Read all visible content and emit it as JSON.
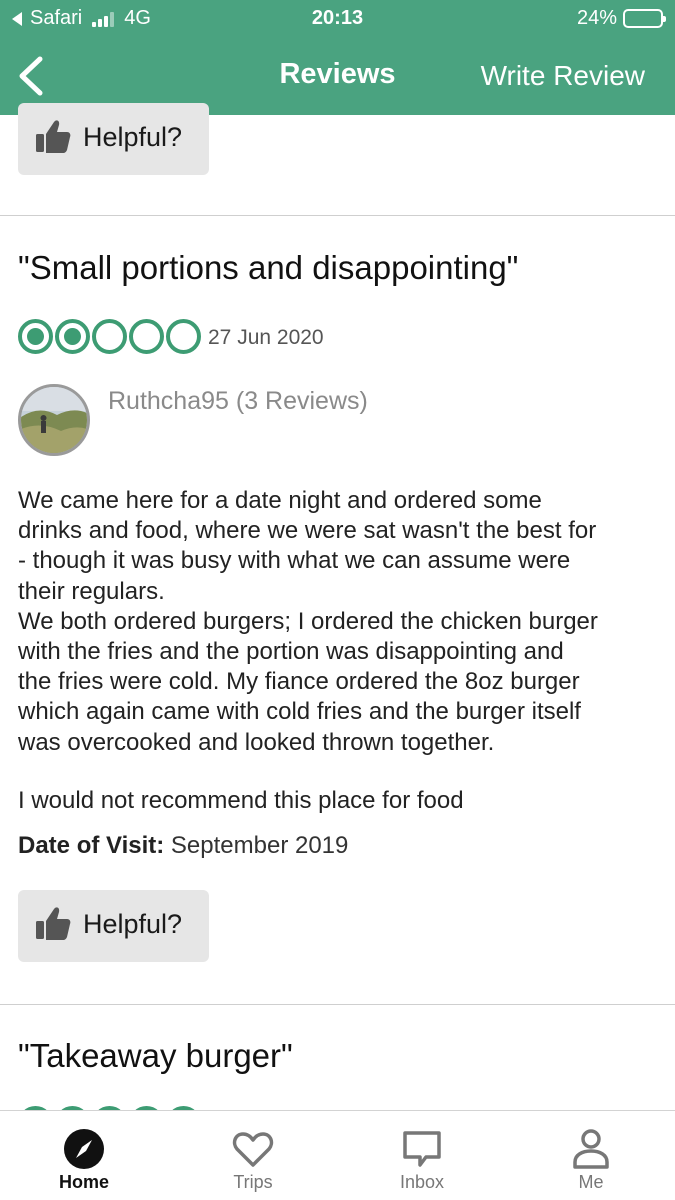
{
  "status_bar": {
    "back_app": "Safari",
    "network": "4G",
    "time": "20:13",
    "battery_percent": "24%",
    "battery_level": 0.24
  },
  "nav": {
    "back_icon": "chevron-left-icon",
    "title": "Reviews",
    "write_review": "Write Review"
  },
  "top_helpful": {
    "label": "Helpful?",
    "icon": "thumbs-up-icon"
  },
  "review": {
    "title": "\"Small portions and disappointing\"",
    "rating": 2,
    "rating_max": 5,
    "date": "27 Jun 2020",
    "reviewer": "Ruthcha95 (3 Reviews)",
    "body": "We came here for a date night and ordered some\ndrinks and food, where we were sat wasn't the best for\n- though it was busy with what we can assume were\ntheir regulars.\nWe both ordered burgers; I ordered the chicken burger\nwith the fries and the portion was disappointing and\nthe fries were cold. My fiance ordered the 8oz burger\nwhich again came with cold fries and the burger itself\nwas overcooked and looked thrown together.",
    "recommendation": "I would not recommend this place for food",
    "visit_label": "Date of Visit:",
    "visit_value": "September 2019",
    "helpful_label": "Helpful?"
  },
  "next_review": {
    "title": "\"Takeaway burger\""
  },
  "tabbar": [
    {
      "label": "Home",
      "icon": "compass-icon",
      "active": true
    },
    {
      "label": "Trips",
      "icon": "heart-icon",
      "active": false
    },
    {
      "label": "Inbox",
      "icon": "speech-bubble-icon",
      "active": false
    },
    {
      "label": "Me",
      "icon": "person-icon",
      "active": false
    }
  ],
  "colors": {
    "brand_green": "#4aa380",
    "bubble_green": "#3d9c73",
    "button_gray": "#e6e6e6"
  }
}
